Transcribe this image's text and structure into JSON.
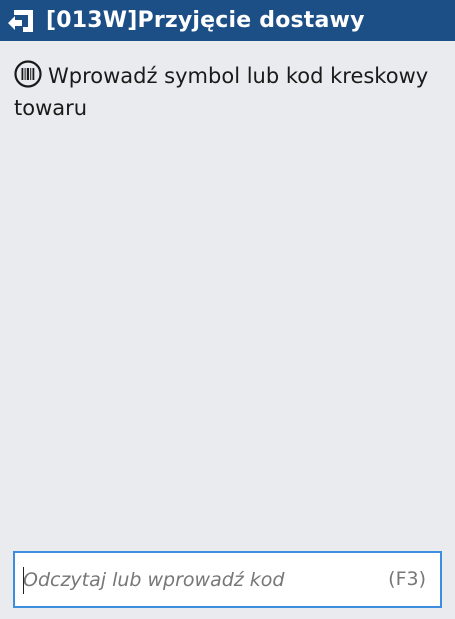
{
  "header": {
    "title": "[013W]Przyjęcie dostawy",
    "back_icon": "back-arrow-icon",
    "background_color": "#1d4f87"
  },
  "prompt": {
    "icon": "barcode-icon",
    "text": "Wprowadź symbol lub kod kreskowy towaru"
  },
  "scan_input": {
    "placeholder": "Odczytaj lub wprowadź kod",
    "value": "",
    "shortcut": "(F3)",
    "border_color": "#3e8ee0"
  }
}
